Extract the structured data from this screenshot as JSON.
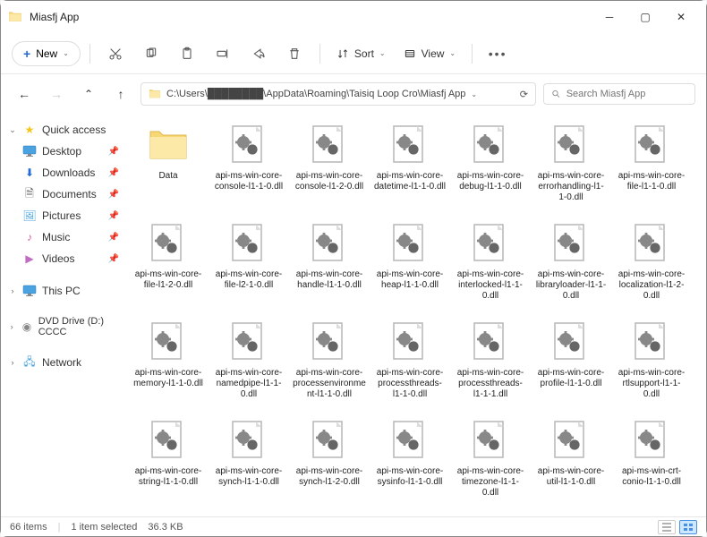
{
  "window": {
    "title": "Miasfj App"
  },
  "toolbar": {
    "new": "New",
    "sort": "Sort",
    "view": "View"
  },
  "address": {
    "path": "C:\\Users\\████████\\AppData\\Roaming\\Taisiq Loop Cro\\Miasfj App"
  },
  "search": {
    "placeholder": "Search Miasfj App"
  },
  "sidebar": {
    "quick": "Quick access",
    "items": [
      {
        "label": "Desktop"
      },
      {
        "label": "Downloads"
      },
      {
        "label": "Documents"
      },
      {
        "label": "Pictures"
      },
      {
        "label": "Music"
      },
      {
        "label": "Videos"
      }
    ],
    "thispc": "This PC",
    "dvd": "DVD Drive (D:) CCCC",
    "network": "Network"
  },
  "files": [
    {
      "type": "folder",
      "name": "Data"
    },
    {
      "type": "dll",
      "name": "api-ms-win-core-console-l1-1-0.dll"
    },
    {
      "type": "dll",
      "name": "api-ms-win-core-console-l1-2-0.dll"
    },
    {
      "type": "dll",
      "name": "api-ms-win-core-datetime-l1-1-0.dll"
    },
    {
      "type": "dll",
      "name": "api-ms-win-core-debug-l1-1-0.dll"
    },
    {
      "type": "dll",
      "name": "api-ms-win-core-errorhandling-l1-1-0.dll"
    },
    {
      "type": "dll",
      "name": "api-ms-win-core-file-l1-1-0.dll"
    },
    {
      "type": "dll",
      "name": "api-ms-win-core-file-l1-2-0.dll"
    },
    {
      "type": "dll",
      "name": "api-ms-win-core-file-l2-1-0.dll"
    },
    {
      "type": "dll",
      "name": "api-ms-win-core-handle-l1-1-0.dll"
    },
    {
      "type": "dll",
      "name": "api-ms-win-core-heap-l1-1-0.dll"
    },
    {
      "type": "dll",
      "name": "api-ms-win-core-interlocked-l1-1-0.dll"
    },
    {
      "type": "dll",
      "name": "api-ms-win-core-libraryloader-l1-1-0.dll"
    },
    {
      "type": "dll",
      "name": "api-ms-win-core-localization-l1-2-0.dll"
    },
    {
      "type": "dll",
      "name": "api-ms-win-core-memory-l1-1-0.dll"
    },
    {
      "type": "dll",
      "name": "api-ms-win-core-namedpipe-l1-1-0.dll"
    },
    {
      "type": "dll",
      "name": "api-ms-win-core-processenvironment-l1-1-0.dll"
    },
    {
      "type": "dll",
      "name": "api-ms-win-core-processthreads-l1-1-0.dll"
    },
    {
      "type": "dll",
      "name": "api-ms-win-core-processthreads-l1-1-1.dll"
    },
    {
      "type": "dll",
      "name": "api-ms-win-core-profile-l1-1-0.dll"
    },
    {
      "type": "dll",
      "name": "api-ms-win-core-rtlsupport-l1-1-0.dll"
    },
    {
      "type": "dll",
      "name": "api-ms-win-core-string-l1-1-0.dll"
    },
    {
      "type": "dll",
      "name": "api-ms-win-core-synch-l1-1-0.dll"
    },
    {
      "type": "dll",
      "name": "api-ms-win-core-synch-l1-2-0.dll"
    },
    {
      "type": "dll",
      "name": "api-ms-win-core-sysinfo-l1-1-0.dll"
    },
    {
      "type": "dll",
      "name": "api-ms-win-core-timezone-l1-1-0.dll"
    },
    {
      "type": "dll",
      "name": "api-ms-win-core-util-l1-1-0.dll"
    },
    {
      "type": "dll",
      "name": "api-ms-win-crt-conio-l1-1-0.dll"
    }
  ],
  "status": {
    "count": "66 items",
    "selected": "1 item selected",
    "size": "36.3 KB"
  }
}
